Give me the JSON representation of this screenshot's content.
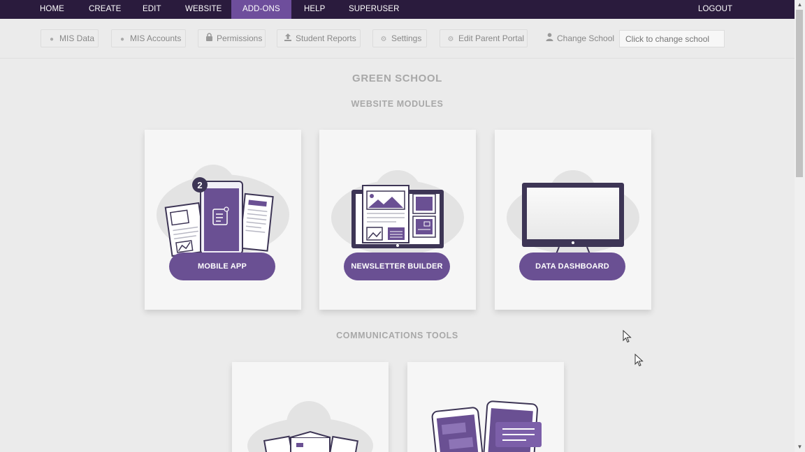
{
  "topnav": {
    "items": [
      {
        "label": "HOME"
      },
      {
        "label": "CREATE"
      },
      {
        "label": "EDIT"
      },
      {
        "label": "WEBSITE"
      },
      {
        "label": "ADD-ONS",
        "active": true
      },
      {
        "label": "HELP"
      },
      {
        "label": "SUPERUSER"
      }
    ],
    "logout": "LOGOUT"
  },
  "subnav": {
    "mis_data": "MIS Data",
    "mis_accounts": "MIS Accounts",
    "permissions": "Permissions",
    "student_reports": "Student Reports",
    "settings": "Settings",
    "edit_parent_portal": "Edit Parent Portal",
    "change_school": "Change School",
    "school_placeholder": "Click to change school"
  },
  "page": {
    "school_name": "GREEN SCHOOL",
    "website_modules": "WEBSITE MODULES",
    "communications_tools": "COMMUNICATIONS TOOLS"
  },
  "modules": [
    {
      "label": "MOBILE APP",
      "icon": "mobile-app-illustration",
      "badge": "2"
    },
    {
      "label": "NEWSLETTER BUILDER",
      "icon": "newsletter-illustration"
    },
    {
      "label": "DATA DASHBOARD",
      "icon": "monitor-illustration"
    }
  ],
  "colors": {
    "nav_bg": "#2a1b3d",
    "nav_active": "#6e4e9c",
    "accent": "#6a5093",
    "page_bg": "#ebebeb"
  }
}
